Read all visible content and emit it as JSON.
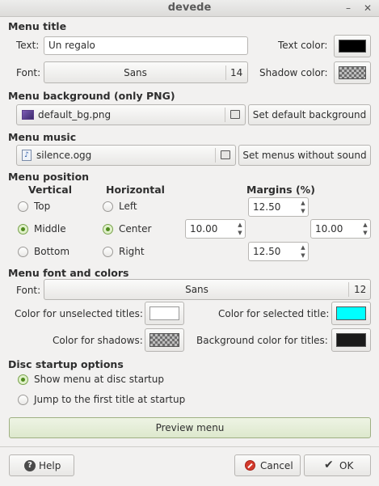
{
  "window": {
    "title": "devede",
    "min_glyph": "–",
    "close_glyph": "✕"
  },
  "menu_title": {
    "header": "Menu title",
    "text_label": "Text:",
    "text_value": "Un regalo",
    "text_color_label": "Text color:",
    "font_label": "Font:",
    "font_name": "Sans",
    "font_size": "14",
    "shadow_color_label": "Shadow color:"
  },
  "menu_background": {
    "header": "Menu background (only PNG)",
    "file": "default_bg.png",
    "set_default_button": "Set default background"
  },
  "menu_music": {
    "header": "Menu music",
    "file": "silence.ogg",
    "without_sound_button": "Set menus without sound"
  },
  "menu_position": {
    "header": "Menu position",
    "vertical_label": "Vertical",
    "horizontal_label": "Horizontal",
    "margins_label": "Margins (%)",
    "vertical_options": [
      "Top",
      "Middle",
      "Bottom"
    ],
    "vertical_selected": "Middle",
    "horizontal_options": [
      "Left",
      "Center",
      "Right"
    ],
    "horizontal_selected": "Center",
    "margin_top": "12.50",
    "margin_left": "10.00",
    "margin_right": "10.00",
    "margin_bottom": "12.50"
  },
  "menu_font": {
    "header": "Menu font and colors",
    "font_label": "Font:",
    "font_name": "Sans",
    "font_size": "12",
    "unselected_label": "Color for unselected titles:",
    "selected_label": "Color for selected title:",
    "shadows_label": "Color for shadows:",
    "bg_titles_label": "Background color for titles:"
  },
  "disc_startup": {
    "header": "Disc startup options",
    "options": [
      "Show menu at disc startup",
      "Jump to the first title at startup"
    ],
    "selected": "Show menu at disc startup"
  },
  "buttons": {
    "preview": "Preview menu",
    "help": "Help",
    "cancel": "Cancel",
    "ok": "OK"
  },
  "colors": {
    "text_color": "#000000",
    "unselected_color": "#ffffff",
    "selected_color": "#00ffff",
    "bg_titles_color": "#1a1a1a",
    "radio_accent": "#4f8a1e"
  },
  "icons": {
    "image_file": "image-file-icon",
    "audio_file": "audio-file-icon",
    "open_file": "open-file-icon",
    "help": "help-icon",
    "cancel": "cancel-icon",
    "ok": "ok-check-icon"
  }
}
